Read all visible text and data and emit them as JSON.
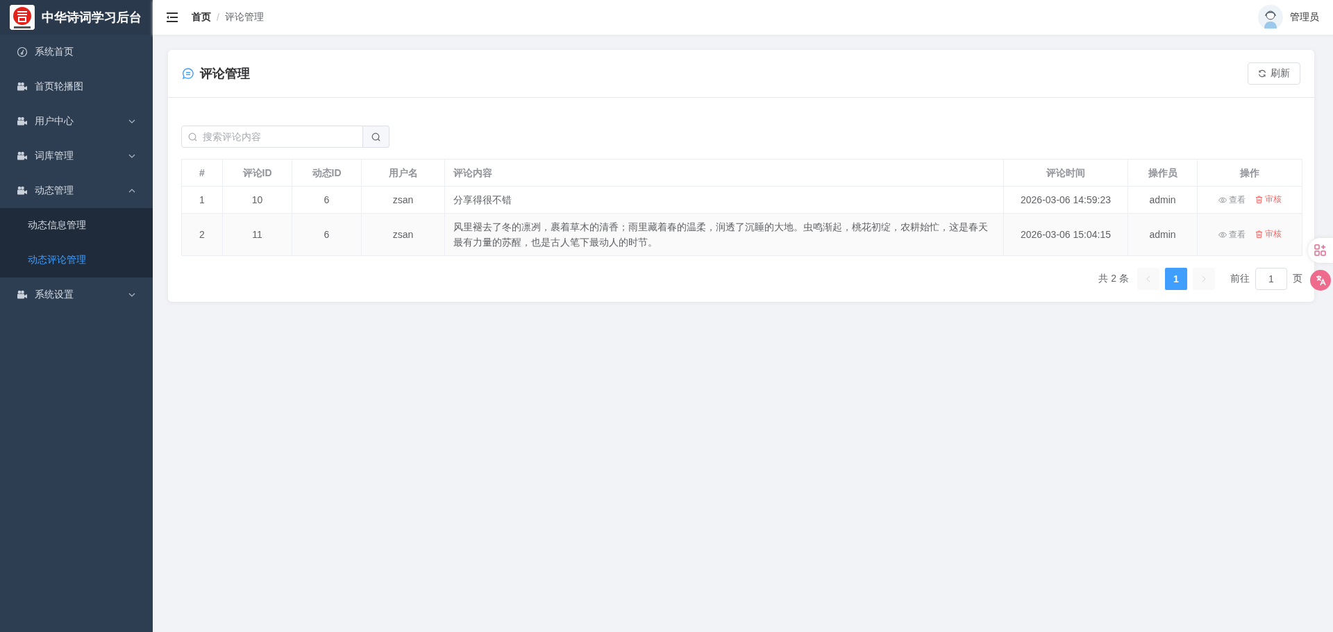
{
  "sidebar": {
    "title": "中华诗词学习后台",
    "items": [
      {
        "label": "系统首页",
        "kind": "link",
        "selected": false
      },
      {
        "label": "首页轮播图",
        "kind": "link",
        "selected": false
      },
      {
        "label": "用户中心",
        "kind": "group",
        "expanded": false
      },
      {
        "label": "词库管理",
        "kind": "group",
        "expanded": false
      },
      {
        "label": "动态管理",
        "kind": "group",
        "expanded": true,
        "children": [
          {
            "label": "动态信息管理",
            "selected": false
          },
          {
            "label": "动态评论管理",
            "selected": true
          }
        ]
      },
      {
        "label": "系统设置",
        "kind": "group",
        "expanded": false
      }
    ]
  },
  "header": {
    "breadcrumb": [
      "首页",
      "评论管理"
    ],
    "breadcrumb_separator": "/",
    "user": "管理员"
  },
  "panel": {
    "title": "评论管理",
    "refresh": "刷新",
    "search": {
      "placeholder": "搜索评论内容"
    },
    "table": {
      "columns": [
        "#",
        "评论ID",
        "动态ID",
        "用户名",
        "评论内容",
        "评论时间",
        "操作员",
        "操作"
      ],
      "rows": [
        {
          "cells": [
            "1",
            "10",
            "6",
            "zsan",
            "分享得很不错",
            "2026-03-06 14:59:23",
            "admin"
          ],
          "actions": [
            "查看",
            "审核"
          ]
        },
        {
          "cells": [
            "2",
            "11",
            "6",
            "zsan",
            "风里褪去了冬的凛冽，裹着草木的清香；雨里藏着春的温柔，润透了沉睡的大地。虫鸣渐起，桃花初绽，农耕始忙，这是春天最有力量的苏醒，也是古人笔下最动人的时节。",
            "2026-03-06 15:04:15",
            "admin"
          ],
          "actions": [
            "查看",
            "审核"
          ]
        }
      ]
    },
    "pagination": {
      "total": "共 2 条",
      "prev_disabled": true,
      "next_disabled": true,
      "pages": [
        {
          "label": "1",
          "selected": true
        }
      ],
      "goto": "前往",
      "goto_value": "1",
      "suffix": "页"
    }
  }
}
